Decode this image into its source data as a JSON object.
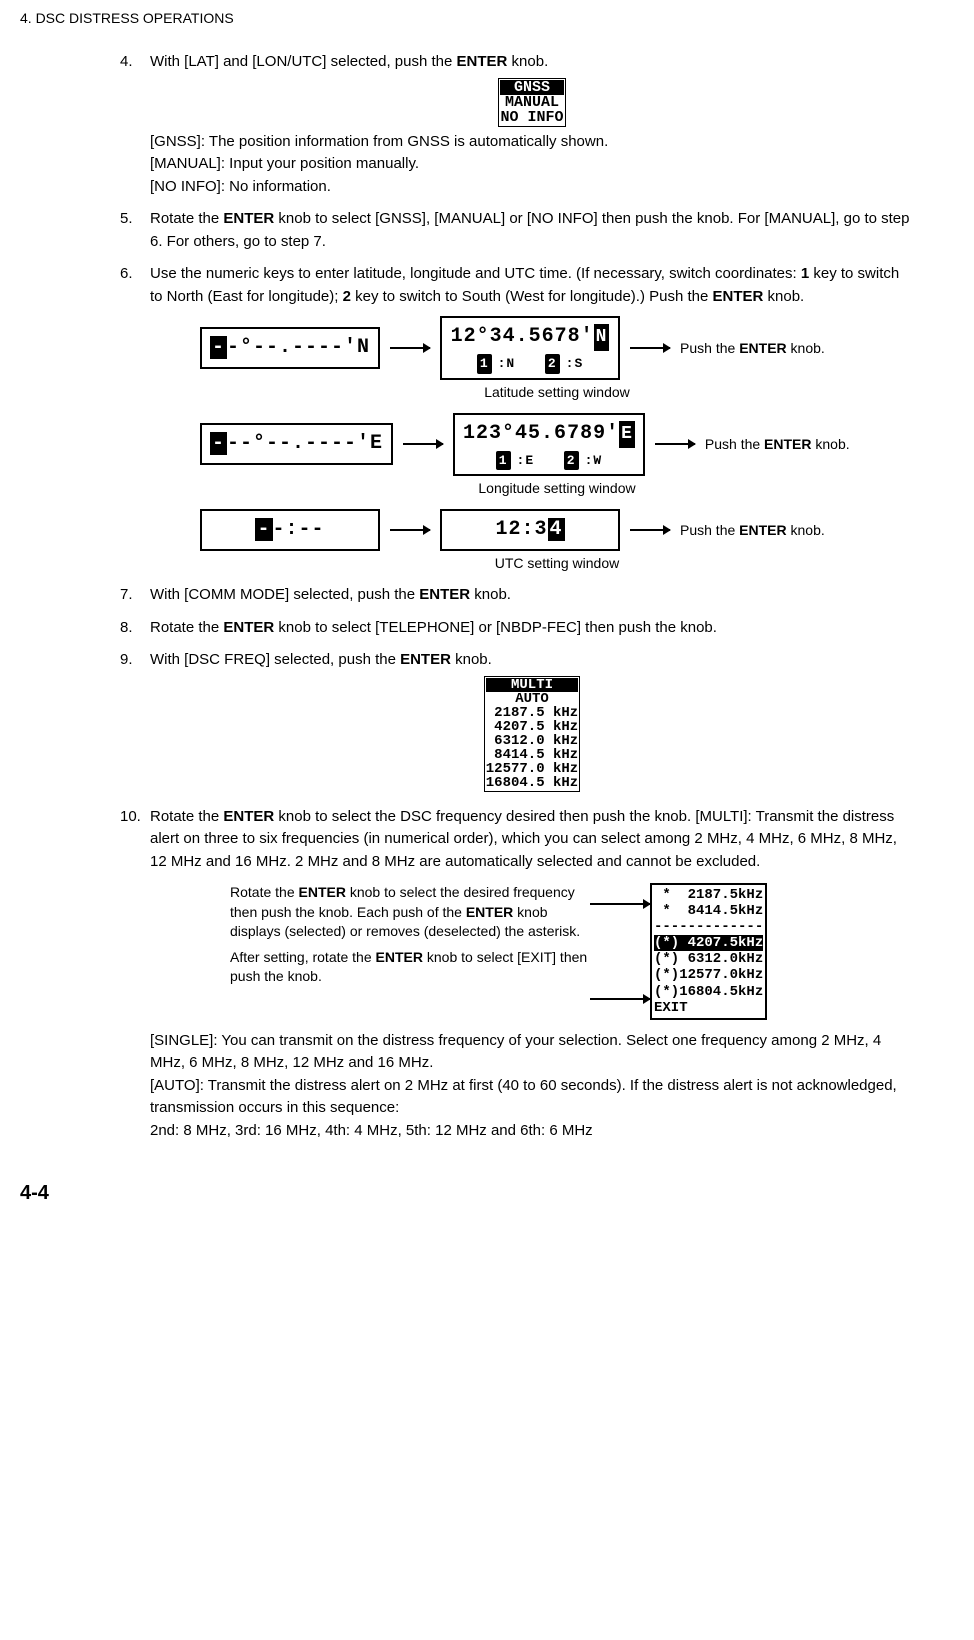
{
  "header": {
    "section": "4.  DSC DISTRESS OPERATIONS"
  },
  "page_number": "4-4",
  "step4": {
    "num": "4.",
    "text_before": "With [LAT] and [LON/UTC] selected, push the ",
    "text_bold": "ENTER",
    "text_after": " knob."
  },
  "lcd_gnss": {
    "l1": "GNSS",
    "l2": "MANUAL",
    "l3": "NO INFO"
  },
  "gnss_desc": {
    "l1": "[GNSS]: The position information from GNSS is automatically shown.",
    "l2": "[MANUAL]: Input your position manually.",
    "l3": "[NO INFO]: No information."
  },
  "step5": {
    "num": "5.",
    "t1": "Rotate the ",
    "b1": "ENTER",
    "t2": " knob to select [GNSS], [MANUAL] or [NO INFO] then push the knob. For [MANUAL], go to step 6. For others, go to step 7."
  },
  "step6": {
    "num": "6.",
    "t1": "Use the numeric keys to enter latitude, longitude and UTC time. (If necessary, switch coordinates: ",
    "b1": "1",
    "t2": " key to switch to North (East for longitude); ",
    "b2": "2",
    "t3": " key to switch to South (West for longitude).) Push the ",
    "b3": "ENTER",
    "t4": " knob."
  },
  "diagram": {
    "lat_blank": "-°--.----'N",
    "lat_value": "12°34.5678'",
    "lat_dir": "N",
    "lat_k1": "1",
    "lat_k1l": ":N",
    "lat_k2": "2",
    "lat_k2l": ":S",
    "lat_caption": "Latitude setting window",
    "lon_blank": "--°--.----'E",
    "lon_value": "123°45.6789'",
    "lon_dir": "E",
    "lon_k1": "1",
    "lon_k1l": ":E",
    "lon_k2": "2",
    "lon_k2l": ":W",
    "lon_caption": "Longitude setting window",
    "utc_blank": "-:--",
    "utc_value": "12:3",
    "utc_caption": "UTC setting window",
    "side_before": "Push the ",
    "side_bold": "ENTER",
    "side_after": " knob."
  },
  "step7": {
    "num": "7.",
    "t1": "With [COMM MODE] selected, push the ",
    "b1": "ENTER",
    "t2": " knob."
  },
  "step8": {
    "num": "8.",
    "t1": "Rotate the ",
    "b1": "ENTER",
    "t2": " knob to select [TELEPHONE] or [NBDP-FEC] then push the knob."
  },
  "step9": {
    "num": "9.",
    "t1": "With [DSC FREQ] selected, push the ",
    "b1": "ENTER",
    "t2": " knob."
  },
  "lcd_multi": {
    "l1": "MULTI",
    "l2": "AUTO",
    "l3": " 2187.5 kHz",
    "l4": " 4207.5 kHz",
    "l5": " 6312.0 kHz",
    "l6": " 8414.5 kHz",
    "l7": "12577.0 kHz",
    "l8": "16804.5 kHz"
  },
  "step10": {
    "num": "10.",
    "t1": "Rotate the ",
    "b1": "ENTER",
    "t2": " knob to select the DSC frequency desired then push the knob. [MULTI]: Transmit the distress alert on three to six frequencies (in numerical order), which you can select among 2 MHz, 4 MHz, 6 MHz, 8 MHz, 12 MHz and 16 MHz. 2 MHz and 8 MHz are automatically selected and cannot be excluded."
  },
  "multi_fig": {
    "p1_t1": "Rotate the ",
    "p1_b1": "ENTER",
    "p1_t2": " knob to select the desired frequency then push the knob. Each push of the ",
    "p1_b2": "ENTER",
    "p1_t3": " knob displays (selected) or removes (deselected) the asterisk.",
    "p2_t1": "After setting, rotate the ",
    "p2_b1": "ENTER",
    "p2_t2": " knob to select [EXIT] then push the knob.",
    "lcd_l1": " *  2187.5kHz",
    "lcd_l2": " *  8414.5kHz",
    "lcd_l3": "-------------",
    "lcd_l4": "(*) 4207.5kHz",
    "lcd_l5": "(*) 6312.0kHz",
    "lcd_l6": "(*)12577.0kHz",
    "lcd_l7": "(*)16804.5kHz",
    "lcd_l8": "EXIT"
  },
  "single_auto": {
    "l1": "[SINGLE]: You can transmit on the distress frequency of your selection. Select one frequency among 2 MHz, 4 MHz, 6 MHz, 8 MHz, 12 MHz and 16 MHz.",
    "l2": "[AUTO]: Transmit the distress alert on 2 MHz at first (40 to 60 seconds). If the distress alert is not acknowledged, transmission occurs in this sequence:",
    "l3": "2nd: 8 MHz, 3rd: 16 MHz, 4th: 4 MHz, 5th: 12 MHz and 6th: 6 MHz"
  }
}
